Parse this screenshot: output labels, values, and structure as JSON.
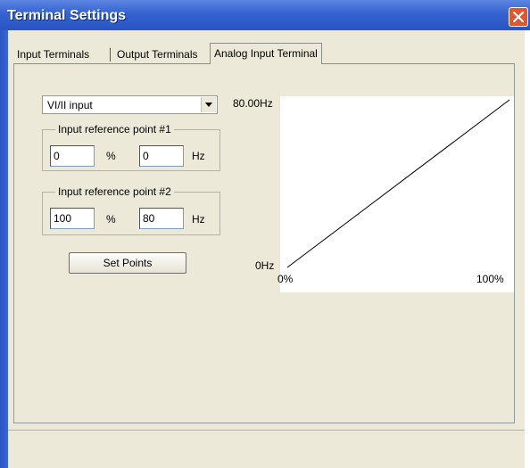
{
  "window": {
    "title": "Terminal Settings",
    "accent_color": "#3462cf",
    "close_icon": "close-icon"
  },
  "tabs": [
    {
      "label": "Input Terminals",
      "active": false
    },
    {
      "label": "Output Terminals",
      "active": false
    },
    {
      "label": "Analog Input Terminal",
      "active": true
    }
  ],
  "input_select": {
    "value": "VI/II input",
    "icon": "chevron-down-icon"
  },
  "ref_point_1": {
    "legend": "Input reference point #1",
    "percent_value": "0",
    "percent_unit": "%",
    "hz_value": "0",
    "hz_unit": "Hz"
  },
  "ref_point_2": {
    "legend": "Input reference point #2",
    "percent_value": "100",
    "percent_unit": "%",
    "hz_value": "80",
    "hz_unit": "Hz"
  },
  "set_points_label": "Set Points",
  "chart_data": {
    "type": "line",
    "series": [
      {
        "x": [
          0,
          100
        ],
        "y": [
          0,
          80
        ]
      }
    ],
    "xlim": [
      0,
      100
    ],
    "ylim": [
      0,
      80
    ],
    "x_tick_labels": [
      "0%",
      "100%"
    ],
    "y_tick_labels": [
      "0Hz",
      "80.00Hz"
    ],
    "grid": false,
    "line_color": "#000000"
  }
}
